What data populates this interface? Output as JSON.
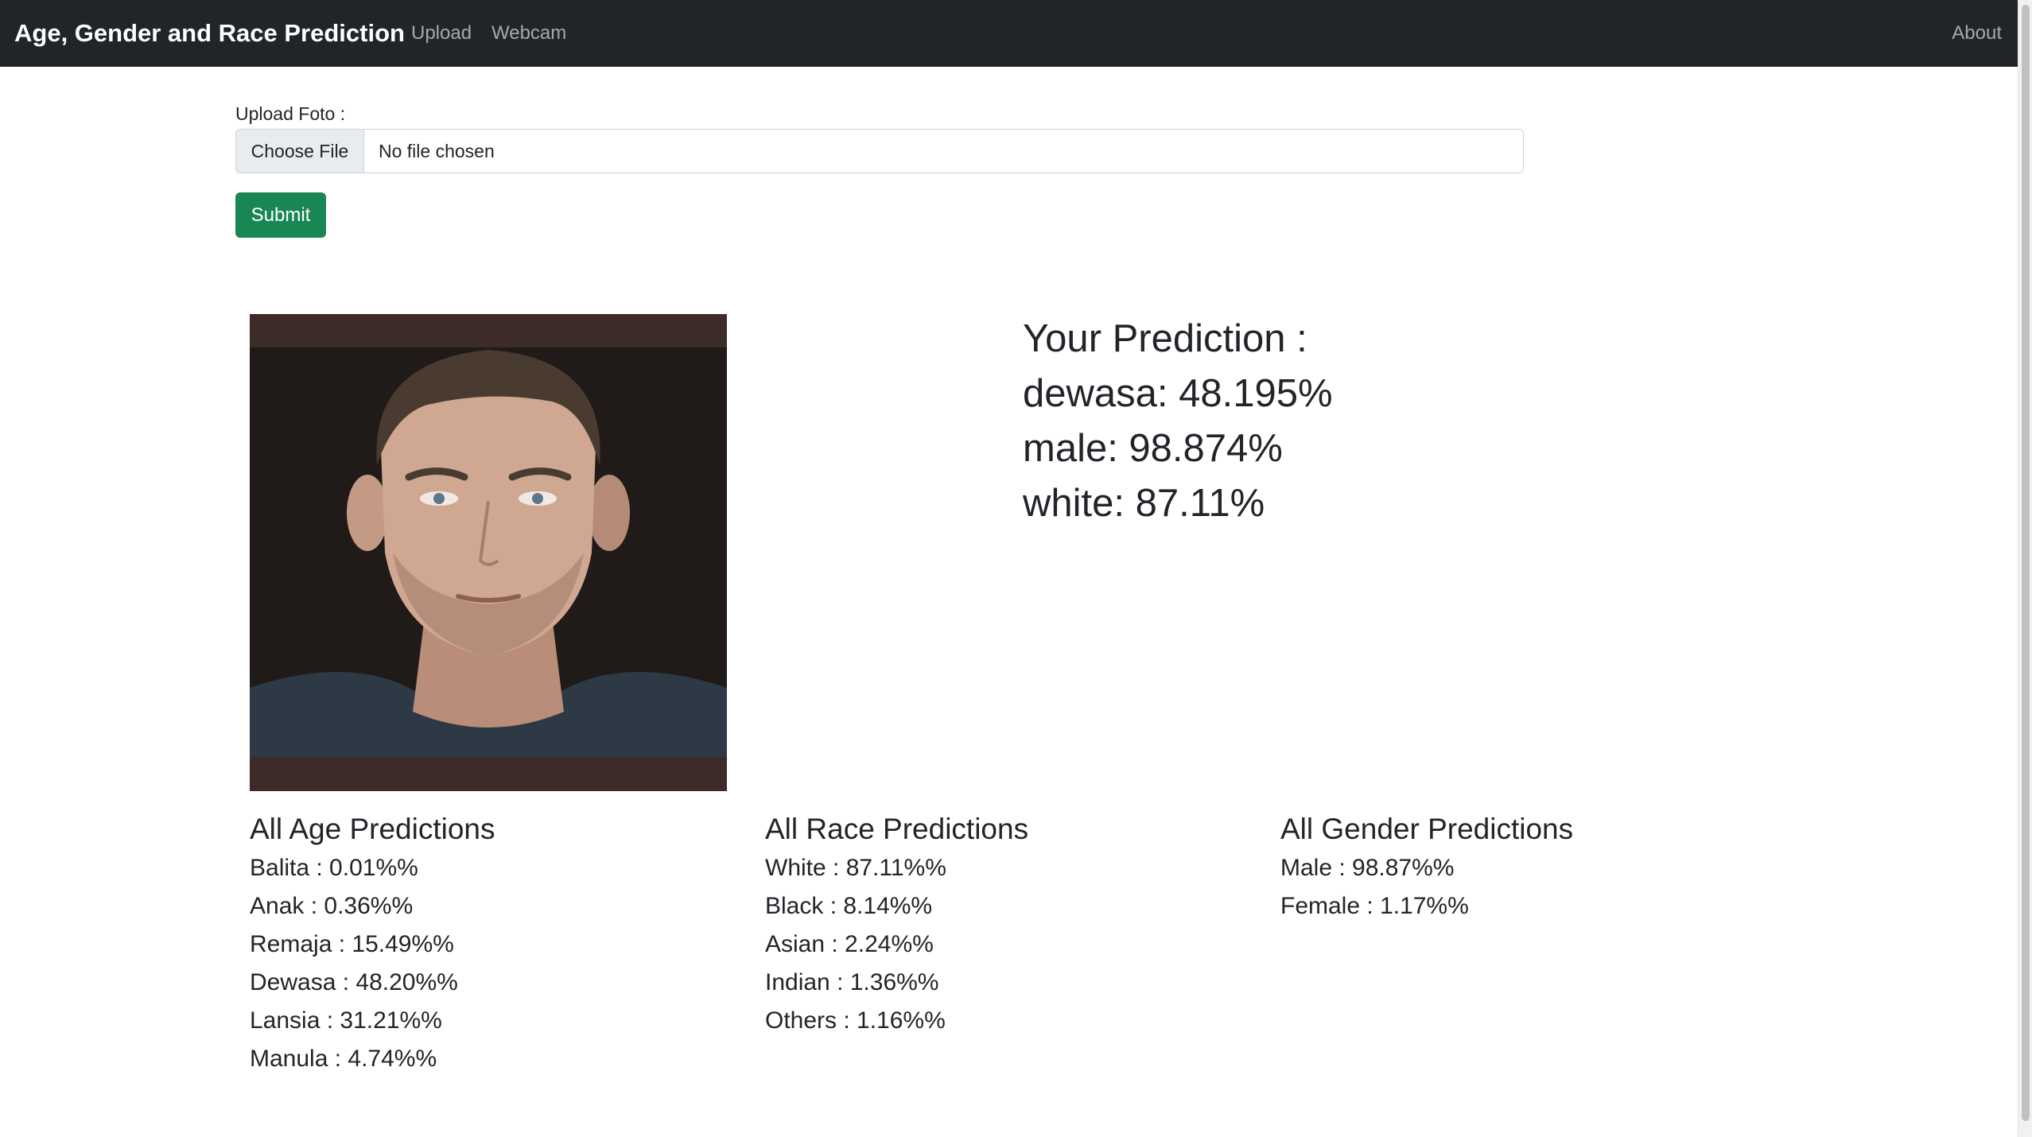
{
  "navbar": {
    "brand": "Age, Gender and Race Prediction",
    "links": [
      "Upload",
      "Webcam"
    ],
    "about": "About"
  },
  "form": {
    "label": "Upload Foto :",
    "file_button": "Choose File",
    "file_status": "No file chosen",
    "submit": "Submit"
  },
  "prediction": {
    "title": "Your Prediction :",
    "lines": [
      "dewasa: 48.195%",
      "male: 98.874%",
      "white: 87.11%"
    ]
  },
  "age": {
    "title": "All Age Predictions",
    "items": [
      "Balita : 0.01%%",
      "Anak : 0.36%%",
      "Remaja : 15.49%%",
      "Dewasa : 48.20%%",
      "Lansia : 31.21%%",
      "Manula : 4.74%%"
    ]
  },
  "race": {
    "title": "All Race Predictions",
    "items": [
      "White : 87.11%%",
      "Black : 8.14%%",
      "Asian : 2.24%%",
      "Indian : 1.36%%",
      "Others : 1.16%%"
    ]
  },
  "gender": {
    "title": "All Gender Predictions",
    "items": [
      "Male : 98.87%%",
      "Female : 1.17%%"
    ]
  },
  "colors": {
    "navbar": "#212529",
    "submit": "#198754",
    "photo_border": "#3d2b29"
  }
}
